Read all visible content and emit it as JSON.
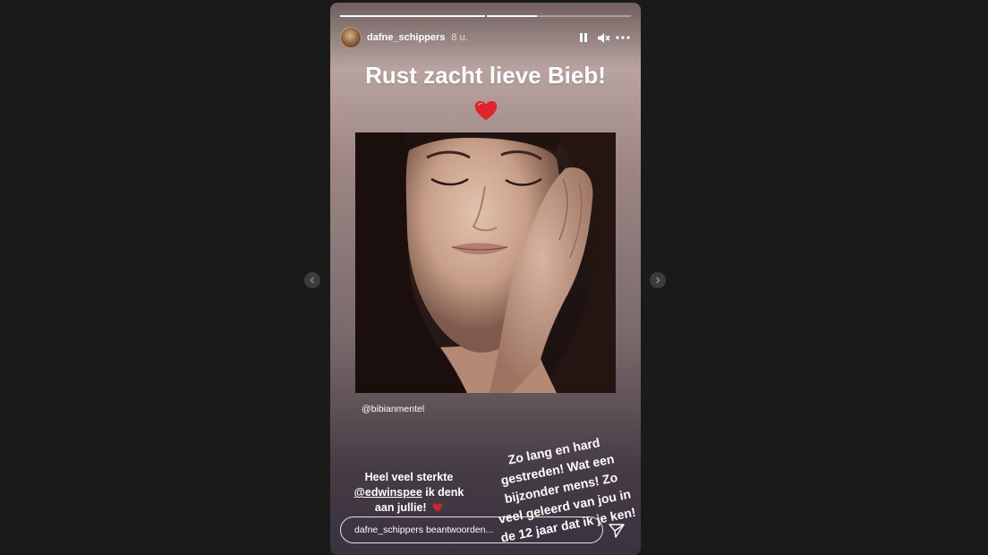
{
  "story": {
    "progress": [
      1.0,
      0.35
    ],
    "username": "dafne_schippers",
    "time": "8 u.",
    "title": "Rust zacht lieve Bieb!",
    "mention": "@bibianmentel",
    "caption_left": {
      "line1": "Heel veel sterkte",
      "tag": "@edwinspee",
      "line2_rest": " ik denk",
      "line3": "aan jullie!"
    },
    "caption_right": [
      "Zo lang en hard",
      "gestreden! Wat een",
      "bijzonder mens! Zo",
      "veel geleerd van jou in",
      "de 12 jaar dat ik je ken!"
    ],
    "reply_placeholder": "dafne_schippers beantwoorden..."
  },
  "colors": {
    "background": "#1a1a1a",
    "heart": "#e0242c",
    "text": "#ffffff"
  },
  "icons": [
    "pause-icon",
    "mute-icon",
    "more-icon",
    "heart-icon",
    "send-icon",
    "chevron-left-icon",
    "chevron-right-icon"
  ]
}
